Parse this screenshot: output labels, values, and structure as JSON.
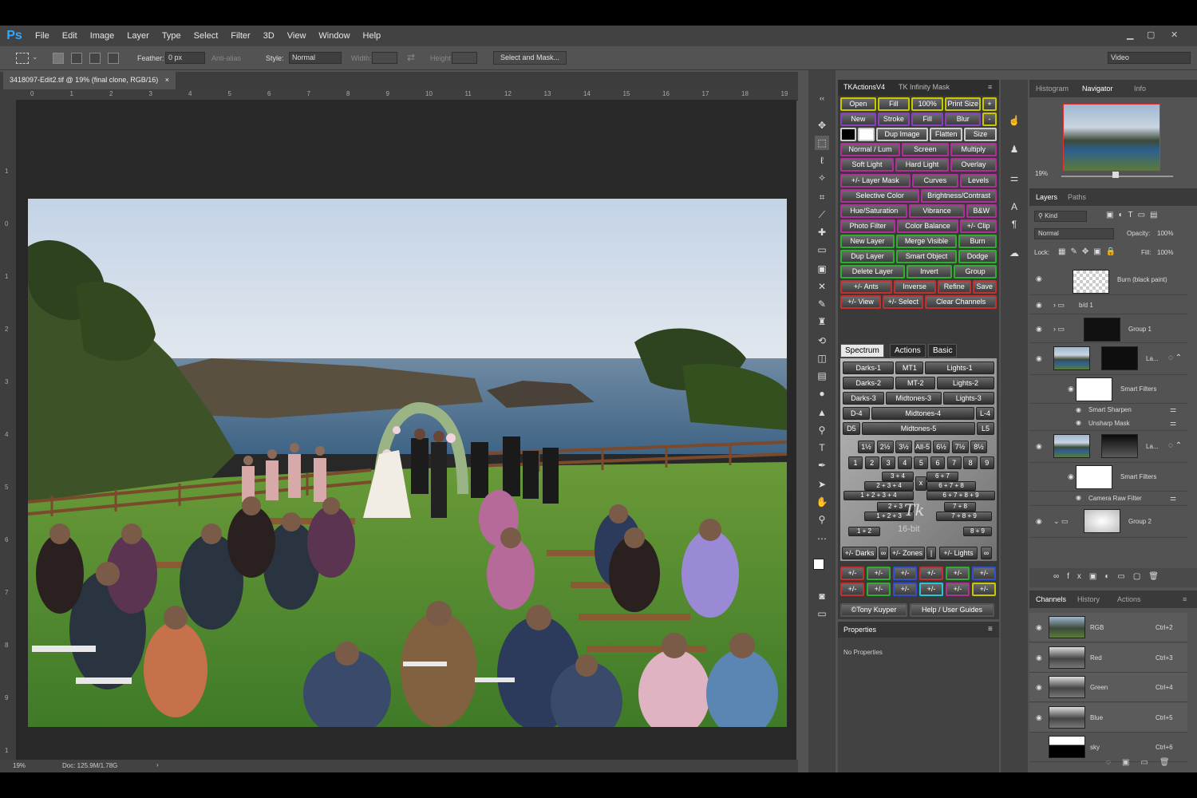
{
  "app": {
    "logo": "Ps",
    "menu": [
      "File",
      "Edit",
      "Image",
      "Layer",
      "Type",
      "Select",
      "Filter",
      "3D",
      "View",
      "Window",
      "Help"
    ]
  },
  "options": {
    "feather_label": "Feather:",
    "feather_value": "0 px",
    "antialias_label": "Anti-alias",
    "style_label": "Style:",
    "style_value": "Normal",
    "width_label": "Width:",
    "height_label": "Height:",
    "select_mask_label": "Select and Mask...",
    "workspace_value": "Video"
  },
  "document": {
    "tab_title": "3418097-Edit2.tif @ 19% (final clone, RGB/16)",
    "close_symbol": "×",
    "ruler_h": [
      "0",
      "1",
      "2",
      "3",
      "4",
      "5",
      "6",
      "7",
      "8",
      "9",
      "10",
      "11",
      "12",
      "13",
      "14",
      "15",
      "16",
      "17",
      "18",
      "19"
    ],
    "ruler_v": [
      "1",
      "0",
      "1",
      "2",
      "3",
      "4",
      "5",
      "6",
      "7",
      "8",
      "9",
      "1"
    ],
    "zoom": "19%",
    "doc_info": "Doc: 125.9M/1.78G"
  },
  "tk": {
    "tabs": [
      "TKActionsV4",
      "TK Infinity Mask"
    ],
    "grid": [
      [
        {
          "t": "Open",
          "c": "b-yel"
        },
        {
          "t": "Fill",
          "c": "b-yel"
        },
        {
          "t": "100%",
          "c": "b-yel"
        },
        {
          "t": "Print Size",
          "c": "b-yel"
        },
        {
          "t": "+",
          "c": "b-yel"
        }
      ],
      [
        {
          "t": "New",
          "c": "b-pur"
        },
        {
          "t": "Stroke",
          "c": "b-pur"
        },
        {
          "t": "Fill",
          "c": "b-pur"
        },
        {
          "t": "Blur",
          "c": "b-pur"
        },
        {
          "t": "-",
          "c": "b-yel"
        }
      ],
      [
        {
          "t": "",
          "c": "b-wht"
        },
        {
          "t": "",
          "c": "b-wht"
        },
        {
          "t": "Dup Image",
          "c": "b-wht"
        },
        {
          "t": "Flatten",
          "c": "b-wht"
        },
        {
          "t": "Size",
          "c": "b-wht"
        }
      ],
      [
        {
          "t": "Normal / Lum",
          "c": "b-mag"
        },
        {
          "t": "Screen",
          "c": "b-mag"
        },
        {
          "t": "Multiply",
          "c": "b-mag"
        }
      ],
      [
        {
          "t": "Soft Light",
          "c": "b-mag"
        },
        {
          "t": "Hard Light",
          "c": "b-mag"
        },
        {
          "t": "Overlay",
          "c": "b-mag"
        }
      ],
      [
        {
          "t": "+/- Layer Mask",
          "c": "b-mag"
        },
        {
          "t": "Curves",
          "c": "b-mag"
        },
        {
          "t": "Levels",
          "c": "b-mag"
        }
      ],
      [
        {
          "t": "Selective Color",
          "c": "b-mag"
        },
        {
          "t": "Brightness/Contrast",
          "c": "b-mag"
        }
      ],
      [
        {
          "t": "Hue/Saturation",
          "c": "b-mag"
        },
        {
          "t": "Vibrance",
          "c": "b-mag"
        },
        {
          "t": "B&W",
          "c": "b-mag"
        }
      ],
      [
        {
          "t": "Photo Filter",
          "c": "b-mag"
        },
        {
          "t": "Color Balance",
          "c": "b-mag"
        },
        {
          "t": "+/- Clip",
          "c": "b-mag"
        }
      ],
      [
        {
          "t": "New Layer",
          "c": "b-grn"
        },
        {
          "t": "Merge Visible",
          "c": "b-grn"
        },
        {
          "t": "Burn",
          "c": "b-grn"
        }
      ],
      [
        {
          "t": "Dup Layer",
          "c": "b-grn"
        },
        {
          "t": "Smart Object",
          "c": "b-grn"
        },
        {
          "t": "Dodge",
          "c": "b-grn"
        }
      ],
      [
        {
          "t": "Delete Layer",
          "c": "b-grn"
        },
        {
          "t": "Invert",
          "c": "b-grn"
        },
        {
          "t": "Group",
          "c": "b-grn"
        }
      ],
      [
        {
          "t": "+/- Ants",
          "c": "b-red"
        },
        {
          "t": "Inverse",
          "c": "b-red"
        },
        {
          "t": "Refine",
          "c": "b-red"
        },
        {
          "t": "Save",
          "c": "b-red"
        }
      ],
      [
        {
          "t": "+/- View",
          "c": "b-red"
        },
        {
          "t": "+/- Select",
          "c": "b-red"
        },
        {
          "t": "Clear Channels",
          "c": "b-red"
        }
      ]
    ],
    "spectrum_tabs": [
      "Spectrum",
      "Actions",
      "Basic"
    ],
    "spec_rows": [
      [
        "Darks-1",
        "MT1",
        "Lights-1"
      ],
      [
        "Darks-2",
        "MT-2",
        "Lights-2"
      ],
      [
        "Darks-3",
        "Midtones-3",
        "Lights-3"
      ],
      [
        "D-4",
        "Midtones-4",
        "L-4"
      ],
      [
        "D5",
        "Midtones-5",
        "L5"
      ]
    ],
    "percents": [
      "1½",
      "2½",
      "3½",
      "All-5",
      "6½",
      "7½",
      "8½"
    ],
    "numbers": [
      "1",
      "2",
      "3",
      "4",
      "5",
      "6",
      "7",
      "8",
      "9"
    ],
    "zones_left": [
      "3 + 4",
      "2 + 3 + 4",
      "1 + 2 + 3 + 4",
      "2 + 3",
      "1 + 2 + 3",
      "1 + 2"
    ],
    "zones_right": [
      "6 + 7",
      "6 + 7 + 8",
      "6 + 7 + 8 + 9",
      "7 + 8",
      "7 + 8 + 9",
      "8 + 9"
    ],
    "x_label": "x",
    "logo_text": "Tk",
    "logo_sub": "16-bit",
    "bottom_row": [
      "+/- Darks",
      "∞",
      "+/- Zones",
      "|",
      "+/- Lights",
      "∞"
    ],
    "pm": "+/-",
    "credit": "©Tony Kuyper",
    "guides": "Help / User Guides"
  },
  "properties": {
    "title": "Properties",
    "empty": "No Properties"
  },
  "navigator": {
    "tabs": [
      "Histogram",
      "Navigator",
      "Info"
    ],
    "zoom": "19%"
  },
  "layers": {
    "tabs": [
      "Layers",
      "Paths"
    ],
    "kind": "Kind",
    "blend": "Normal",
    "opacity_label": "Opacity:",
    "opacity": "100%",
    "lock_label": "Lock:",
    "fill_label": "Fill:",
    "fill": "100%",
    "items": [
      {
        "name": "Burn (black paint)"
      },
      {
        "name": "b/d 1"
      },
      {
        "name": "Group 1"
      },
      {
        "name": "La..."
      },
      {
        "name": "Smart Filters"
      },
      {
        "name": "Smart Sharpen"
      },
      {
        "name": "Unsharp Mask"
      },
      {
        "name": "La..."
      },
      {
        "name": "Smart Filters"
      },
      {
        "name": "Camera Raw Filter"
      },
      {
        "name": "Group 2"
      }
    ]
  },
  "channels": {
    "tabs": [
      "Channels",
      "History",
      "Actions"
    ],
    "items": [
      {
        "name": "RGB",
        "key": "Ctrl+2"
      },
      {
        "name": "Red",
        "key": "Ctrl+3"
      },
      {
        "name": "Green",
        "key": "Ctrl+4"
      },
      {
        "name": "Blue",
        "key": "Ctrl+5"
      },
      {
        "name": "sky",
        "key": "Ctrl+6"
      }
    ]
  }
}
